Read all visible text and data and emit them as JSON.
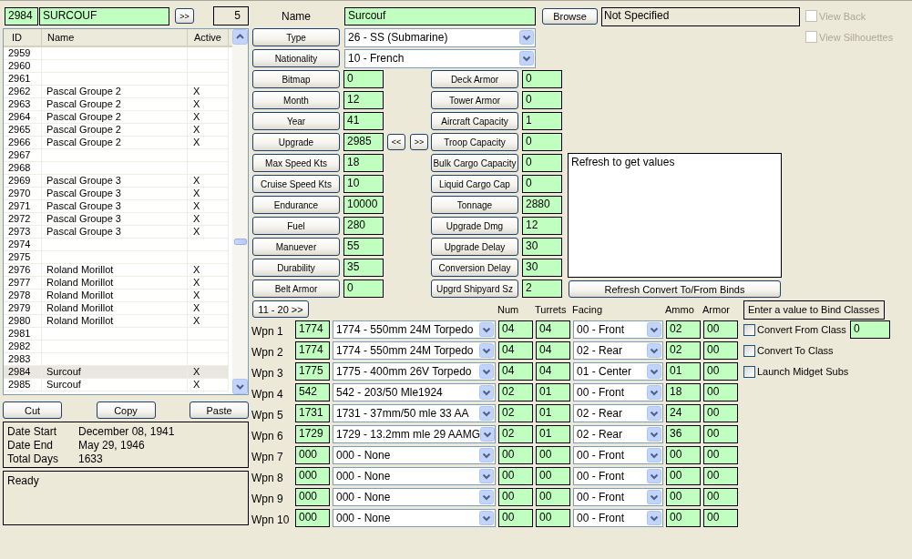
{
  "record": {
    "id": "2984",
    "name": "SURCOUF",
    "next_button": ">>",
    "count": "5"
  },
  "ship_list": {
    "columns": [
      "ID",
      "Name",
      "Active"
    ],
    "rows": [
      {
        "id": "2959",
        "selected": false
      },
      {
        "id": "2960",
        "selected": false
      },
      {
        "id": "2961",
        "selected": false
      },
      {
        "id": "2962",
        "name": "Pascal Groupe 2",
        "active": "X",
        "selected": false
      },
      {
        "id": "2963",
        "name": "Pascal Groupe 2",
        "active": "X",
        "selected": false
      },
      {
        "id": "2964",
        "name": "Pascal Groupe 2",
        "active": "X",
        "selected": false
      },
      {
        "id": "2965",
        "name": "Pascal Groupe 2",
        "active": "X",
        "selected": false
      },
      {
        "id": "2966",
        "name": "Pascal Groupe 2",
        "active": "X",
        "selected": false
      },
      {
        "id": "2967",
        "selected": false
      },
      {
        "id": "2968",
        "selected": false
      },
      {
        "id": "2969",
        "name": "Pascal Groupe 3",
        "active": "X",
        "selected": false
      },
      {
        "id": "2970",
        "name": "Pascal Groupe 3",
        "active": "X",
        "selected": false
      },
      {
        "id": "2971",
        "name": "Pascal Groupe 3",
        "active": "X",
        "selected": false
      },
      {
        "id": "2972",
        "name": "Pascal Groupe 3",
        "active": "X",
        "selected": false
      },
      {
        "id": "2973",
        "name": "Pascal Groupe 3",
        "active": "X",
        "selected": false
      },
      {
        "id": "2974",
        "selected": false
      },
      {
        "id": "2975",
        "selected": false
      },
      {
        "id": "2976",
        "name": "Roland Morillot",
        "active": "X",
        "selected": false
      },
      {
        "id": "2977",
        "name": "Roland Morillot",
        "active": "X",
        "selected": false
      },
      {
        "id": "2978",
        "name": "Roland Morillot",
        "active": "X",
        "selected": false
      },
      {
        "id": "2979",
        "name": "Roland Morillot",
        "active": "X",
        "selected": false
      },
      {
        "id": "2980",
        "name": "Roland Morillot",
        "active": "X",
        "selected": false
      },
      {
        "id": "2981",
        "selected": false
      },
      {
        "id": "2982",
        "selected": false
      },
      {
        "id": "2983",
        "selected": false
      },
      {
        "id": "2984",
        "name": "Surcouf",
        "active": "X",
        "selected": true
      },
      {
        "id": "2985",
        "name": "Surcouf",
        "active": "X",
        "selected": false
      }
    ]
  },
  "clipboard_buttons": [
    "Cut",
    "Copy",
    "Paste"
  ],
  "dates": [
    {
      "label": "Date Start",
      "value": "December 08, 1941"
    },
    {
      "label": "Date End",
      "value": "May 29, 1946"
    },
    {
      "label": "Total Days",
      "value": "1633"
    }
  ],
  "status": "Ready",
  "name": {
    "label": "Name",
    "value": "Surcouf"
  },
  "bitmap_file": {
    "button": "Browse",
    "value": "Not Specified"
  },
  "view_options": [
    {
      "label": "View Back",
      "checked": false,
      "disabled": true
    },
    {
      "label": "View Silhouettes",
      "checked": false,
      "disabled": true
    }
  ],
  "selects": [
    {
      "button": "Type",
      "value": "26 - SS (Submarine)"
    },
    {
      "button": "Nationality",
      "value": "10 - French"
    }
  ],
  "stats_left": [
    {
      "button": "Bitmap",
      "value": "0"
    },
    {
      "button": "Month",
      "value": "12"
    },
    {
      "button": "Year",
      "value": "41"
    },
    {
      "button": "Upgrade",
      "value": "2985",
      "nav": [
        "<<",
        ">>"
      ]
    },
    {
      "button": "Max Speed Kts",
      "value": "18"
    },
    {
      "button": "Cruise Speed Kts",
      "value": "10"
    },
    {
      "button": "Endurance",
      "value": "10000"
    },
    {
      "button": "Fuel",
      "value": "280"
    },
    {
      "button": "Manuever",
      "value": "55"
    },
    {
      "button": "Durability",
      "value": "35"
    },
    {
      "button": "Belt Armor",
      "value": "0"
    }
  ],
  "stats_right": [
    {
      "button": "Deck Armor",
      "value": "0"
    },
    {
      "button": "Tower Armor",
      "value": "0"
    },
    {
      "button": "Aircraft Capacity",
      "value": "1"
    },
    {
      "button": "Troop Capacity",
      "value": "0"
    },
    {
      "button": "Bulk Cargo Capacity",
      "value": "0"
    },
    {
      "button": "Liquid Cargo Cap",
      "value": "0"
    },
    {
      "button": "Tonnage",
      "value": "2880"
    },
    {
      "button": "Upgrade Dmg",
      "value": "12"
    },
    {
      "button": "Upgrade Delay",
      "value": "30"
    },
    {
      "button": "Conversion Delay",
      "value": "30"
    },
    {
      "button": "Upgrd Shipyard Sz",
      "value": "2"
    }
  ],
  "binds_output": {
    "text": "Refresh to get values",
    "button": "Refresh Convert To/From Binds"
  },
  "weapons": {
    "page_button": "11 - 20 >>",
    "columns": [
      "Num",
      "Turrets",
      "Facing",
      "Ammo",
      "Armor"
    ],
    "rows": [
      {
        "label": "Wpn 1",
        "id": "1774",
        "weapon": "1774 - 550mm 24M Torpedo",
        "num": "04",
        "turrets": "04",
        "facing": "00 - Front",
        "ammo": "02",
        "armor": "00"
      },
      {
        "label": "Wpn 2",
        "id": "1774",
        "weapon": "1774 - 550mm 24M Torpedo",
        "num": "04",
        "turrets": "04",
        "facing": "02 - Rear",
        "ammo": "02",
        "armor": "00"
      },
      {
        "label": "Wpn 3",
        "id": "1775",
        "weapon": "1775 - 400mm 26V Torpedo",
        "num": "04",
        "turrets": "04",
        "facing": "01 - Center",
        "ammo": "01",
        "armor": "00"
      },
      {
        "label": "Wpn 4",
        "id": "542",
        "weapon": "542 - 203/50 Mle1924",
        "num": "02",
        "turrets": "01",
        "facing": "00 - Front",
        "ammo": "18",
        "armor": "00"
      },
      {
        "label": "Wpn 5",
        "id": "1731",
        "weapon": "1731 - 37mm/50 mle 33 AA",
        "num": "02",
        "turrets": "01",
        "facing": "02 - Rear",
        "ammo": "24",
        "armor": "00"
      },
      {
        "label": "Wpn 6",
        "id": "1729",
        "weapon": "1729 - 13.2mm mle 29 AAMG",
        "num": "02",
        "turrets": "01",
        "facing": "02 - Rear",
        "ammo": "36",
        "armor": "00"
      },
      {
        "label": "Wpn 7",
        "id": "000",
        "weapon": "000 - None",
        "num": "00",
        "turrets": "00",
        "facing": "00 - Front",
        "ammo": "00",
        "armor": "00"
      },
      {
        "label": "Wpn 8",
        "id": "000",
        "weapon": "000 - None",
        "num": "00",
        "turrets": "00",
        "facing": "00 - Front",
        "ammo": "00",
        "armor": "00"
      },
      {
        "label": "Wpn 9",
        "id": "000",
        "weapon": "000 - None",
        "num": "00",
        "turrets": "00",
        "facing": "00 - Front",
        "ammo": "00",
        "armor": "00"
      },
      {
        "label": "Wpn 10",
        "id": "000",
        "weapon": "000 - None",
        "num": "00",
        "turrets": "00",
        "facing": "00 - Front",
        "ammo": "00",
        "armor": "00"
      }
    ]
  },
  "class_binds": {
    "hint": "Enter a value to Bind Classes",
    "options": [
      {
        "label": "Convert From Class",
        "checked": false,
        "value": "0"
      },
      {
        "label": "Convert To Class",
        "checked": false
      },
      {
        "label": "Launch Midget Subs",
        "checked": false
      }
    ]
  }
}
